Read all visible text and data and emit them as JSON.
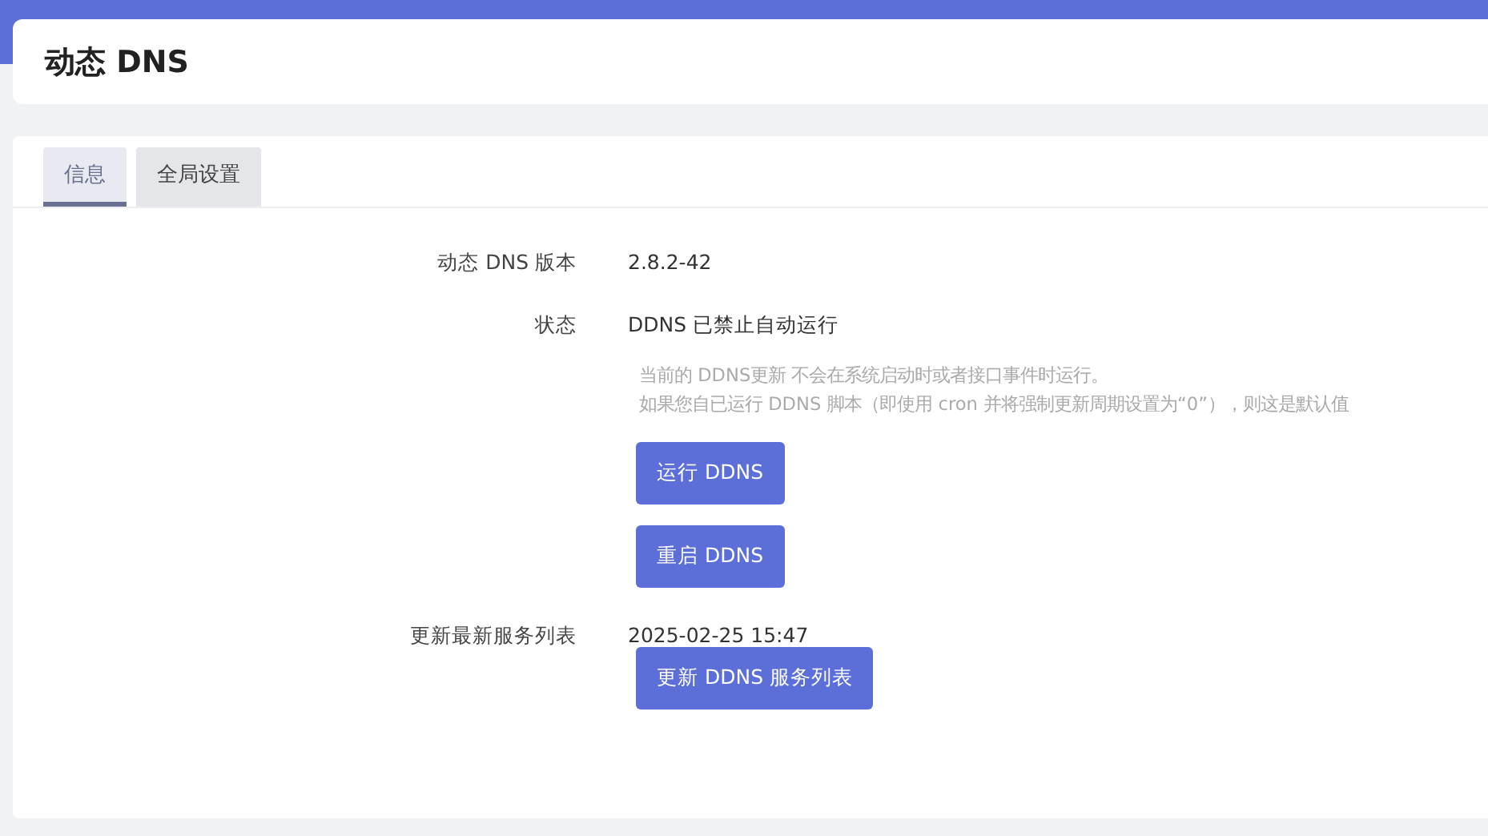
{
  "header": {
    "title": "动态 DNS"
  },
  "tabs": [
    {
      "label": "信息",
      "selected": true
    },
    {
      "label": "全局设置",
      "selected": false
    }
  ],
  "fields": [
    {
      "label": "动态 DNS 版本",
      "value": "2.8.2-42"
    },
    {
      "label": "状态",
      "value": "DDNS 已禁止自动运行",
      "description": [
        "当前的 DDNS更新 不会在系统启动时或者接口事件时运行。",
        "如果您自已运行 DDNS 脚本（即使用 cron 并将强制更新周期设置为“0”），则这是默认值"
      ],
      "buttons": [
        "运行 DDNS",
        "重启 DDNS"
      ]
    },
    {
      "label": "更新最新服务列表",
      "value": "2025-02-25 15:47",
      "buttons": [
        "更新 DDNS 服务列表"
      ]
    }
  ]
}
